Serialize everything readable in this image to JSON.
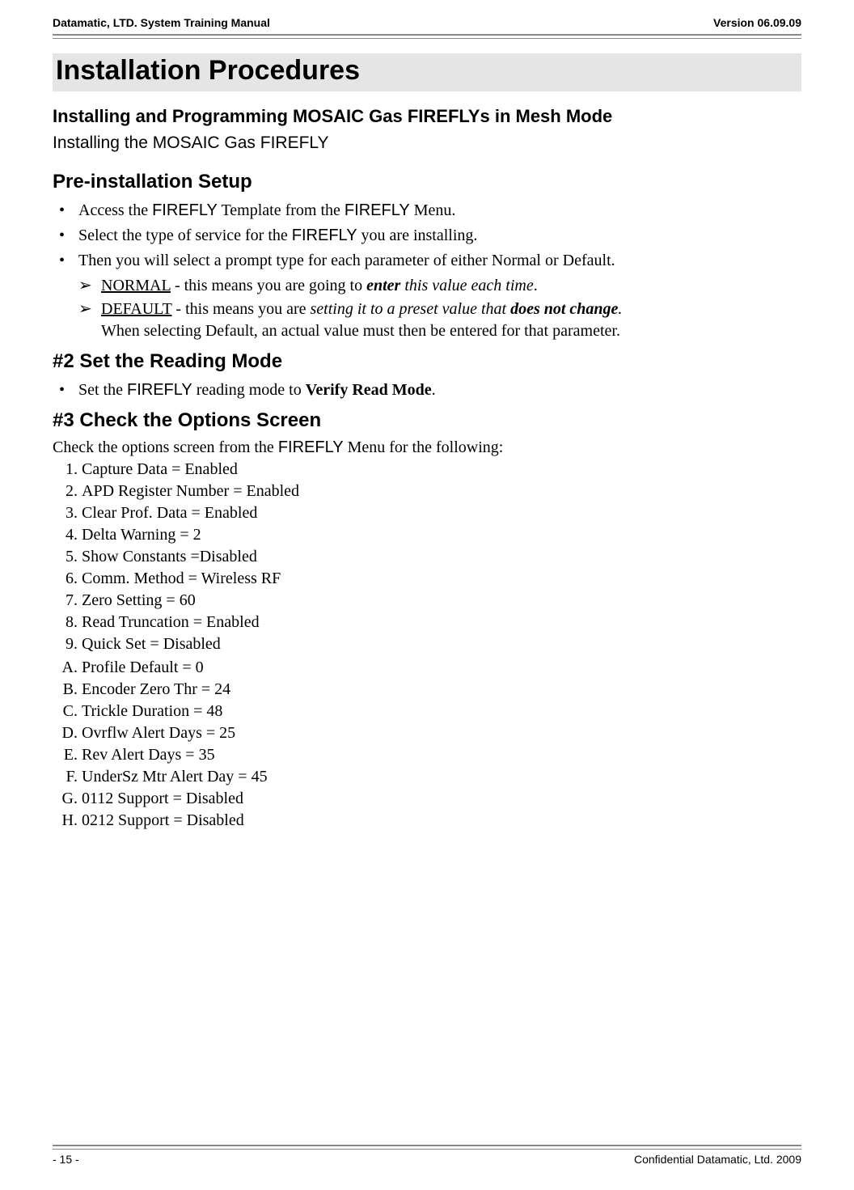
{
  "header": {
    "left": "Datamatic, LTD. System Training  Manual",
    "right": "Version 06.09.09"
  },
  "title": "Installation Procedures",
  "subtitle": "Installing and Programming  MOSAIC Gas FIREFLYs in Mesh Mode",
  "installing_line": "Installing the  MOSAIC Gas FIREFLY",
  "preinstall": {
    "heading": "Pre-installation Setup",
    "b1_a": "Access the ",
    "b1_ff1": "FIREFLY",
    "b1_b": " Template from the ",
    "b1_ff2": "FIREFLY",
    "b1_c": " Menu.",
    "b2_a": "Select the type of service for the ",
    "b2_ff": "FIREFLY",
    "b2_b": " you are installing.",
    "b3": "Then you will select a prompt type for each parameter of either Normal or Default.",
    "sub1_label": "NORMAL",
    "sub1_a": " - this means you are going to ",
    "sub1_enter": "enter",
    "sub1_b": " this value each time",
    "sub1_c": ".",
    "sub2_label": "DEFAULT",
    "sub2_a": " - this means you are ",
    "sub2_b": "setting it to a preset value that ",
    "sub2_bold": "does not change",
    "sub2_c": ".",
    "sub2_tail": "When selecting Default, an actual value must then be entered for that parameter."
  },
  "reading": {
    "heading": "#2 Set the Reading Mode",
    "b1_a": "Set the ",
    "b1_ff": "FIREFLY",
    "b1_b": " reading mode to ",
    "b1_bold": "Verify Read Mode",
    "b1_c": "."
  },
  "options": {
    "heading": "#3 Check the Options Screen",
    "intro_a": "Check the options screen from the ",
    "intro_ff": "FIREFLY",
    "intro_b": " Menu for the following:",
    "num": [
      "Capture Data = Enabled",
      "APD Register Number = Enabled",
      "Clear Prof. Data = Enabled",
      "Delta Warning = 2",
      "Show Constants =Disabled",
      "Comm. Method = Wireless RF",
      "Zero Setting = 60",
      "Read Truncation = Enabled",
      "Quick Set = Disabled"
    ],
    "alpha": [
      "Profile Default = 0",
      "Encoder Zero Thr = 24",
      "Trickle Duration = 48",
      "Ovrflw Alert Days = 25",
      "Rev Alert Days = 35",
      "UnderSz Mtr Alert Day = 45",
      "0112 Support = Disabled",
      "0212 Support = Disabled"
    ]
  },
  "footer": {
    "left": "- 15 -",
    "right": "Confidential Datamatic, Ltd. 2009"
  }
}
